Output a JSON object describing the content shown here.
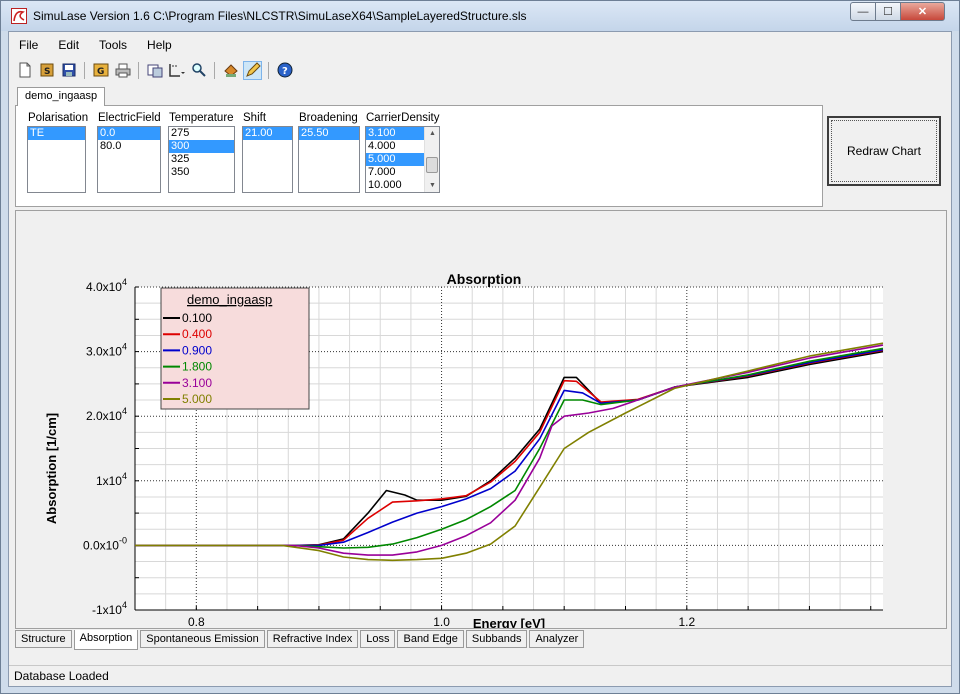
{
  "window": {
    "title": "SimuLase Version 1.6    C:\\Program Files\\NLCSTR\\SimuLaseX64\\SampleLayeredStructure.sls",
    "min_glyph": "—",
    "max_glyph": "☐",
    "close_glyph": "✕"
  },
  "menu": [
    "File",
    "Edit",
    "Tools",
    "Help"
  ],
  "toolbar": [
    "new-file-icon",
    "save-as-icon",
    "save-icon",
    "calculate-icon",
    "print-icon",
    "export-icon",
    "chart-options-icon",
    "zoom-icon",
    "run-icon",
    "pencil-icon",
    "help-icon"
  ],
  "document_tab": "demo_ingaasp",
  "params": {
    "polarisation": {
      "label": "Polarisation",
      "options": [
        "TE"
      ],
      "selected": [
        0
      ]
    },
    "electric_field": {
      "label": "ElectricField",
      "options": [
        "0.0",
        "80.0"
      ],
      "selected": [
        0
      ]
    },
    "temperature": {
      "label": "Temperature",
      "options": [
        "275",
        "300",
        "325",
        "350"
      ],
      "selected": [
        1
      ]
    },
    "shift": {
      "label": "Shift",
      "options": [
        "21.00"
      ],
      "selected": [
        0
      ]
    },
    "broadening": {
      "label": "Broadening",
      "options": [
        "25.50"
      ],
      "selected": [
        0
      ]
    },
    "carrier_density": {
      "label": "CarrierDensity",
      "options": [
        "3.100",
        "4.000",
        "5.000",
        "7.000",
        "10.000"
      ],
      "selected": [
        0,
        2
      ]
    }
  },
  "redraw_button": "Redraw Chart",
  "chart_data": {
    "type": "line",
    "title": "Absorption",
    "xlabel": "Energy [eV]",
    "ylabel": "Absorption [1/cm]",
    "xlim": [
      0.75,
      1.36
    ],
    "ylim": [
      -10000,
      40000
    ],
    "xticks": [
      {
        "v": 0.8,
        "label": "0.8"
      },
      {
        "v": 1.0,
        "label": "1.0"
      },
      {
        "v": 1.2,
        "label": "1.2"
      }
    ],
    "yticks": [
      {
        "v": 40000,
        "base": "4.0x10",
        "exp": "4"
      },
      {
        "v": 30000,
        "base": "3.0x10",
        "exp": "4"
      },
      {
        "v": 20000,
        "base": "2.0x10",
        "exp": "4"
      },
      {
        "v": 10000,
        "base": "1x10",
        "exp": "4"
      },
      {
        "v": 0,
        "base": "0.0x10",
        "exp": "-0"
      },
      {
        "v": -10000,
        "base": "-1x10",
        "exp": "4"
      }
    ],
    "legend_title": "demo_ingaasp",
    "legend_position": "top-left",
    "grid": true,
    "series": [
      {
        "name": "0.100",
        "color": "#000000",
        "points": [
          [
            0.75,
            0
          ],
          [
            0.88,
            0
          ],
          [
            0.9,
            100
          ],
          [
            0.92,
            1000
          ],
          [
            0.94,
            5000
          ],
          [
            0.955,
            8500
          ],
          [
            0.97,
            7800
          ],
          [
            0.98,
            7000
          ],
          [
            1.0,
            7000
          ],
          [
            1.02,
            7600
          ],
          [
            1.04,
            10000
          ],
          [
            1.06,
            13500
          ],
          [
            1.08,
            18000
          ],
          [
            1.1,
            26000
          ],
          [
            1.11,
            26000
          ],
          [
            1.13,
            22000
          ],
          [
            1.16,
            22500
          ],
          [
            1.19,
            24500
          ],
          [
            1.25,
            26000
          ],
          [
            1.3,
            28000
          ],
          [
            1.36,
            30000
          ]
        ]
      },
      {
        "name": "0.400",
        "color": "#dd0000",
        "points": [
          [
            0.75,
            0
          ],
          [
            0.88,
            0
          ],
          [
            0.9,
            50
          ],
          [
            0.92,
            800
          ],
          [
            0.94,
            4200
          ],
          [
            0.96,
            6700
          ],
          [
            0.98,
            6900
          ],
          [
            1.0,
            7200
          ],
          [
            1.02,
            7700
          ],
          [
            1.04,
            9800
          ],
          [
            1.06,
            13000
          ],
          [
            1.08,
            17500
          ],
          [
            1.1,
            25500
          ],
          [
            1.11,
            25400
          ],
          [
            1.13,
            22200
          ],
          [
            1.16,
            22600
          ],
          [
            1.19,
            24500
          ],
          [
            1.25,
            26200
          ],
          [
            1.3,
            28200
          ],
          [
            1.36,
            30200
          ]
        ]
      },
      {
        "name": "0.900",
        "color": "#0000cc",
        "points": [
          [
            0.75,
            0
          ],
          [
            0.88,
            0
          ],
          [
            0.9,
            0
          ],
          [
            0.92,
            500
          ],
          [
            0.94,
            2000
          ],
          [
            0.96,
            3600
          ],
          [
            0.98,
            5000
          ],
          [
            1.0,
            6000
          ],
          [
            1.02,
            7200
          ],
          [
            1.04,
            8800
          ],
          [
            1.06,
            11500
          ],
          [
            1.08,
            16500
          ],
          [
            1.1,
            24000
          ],
          [
            1.115,
            23600
          ],
          [
            1.13,
            22000
          ],
          [
            1.16,
            22500
          ],
          [
            1.19,
            24500
          ],
          [
            1.25,
            26300
          ],
          [
            1.3,
            28300
          ],
          [
            1.36,
            30300
          ]
        ]
      },
      {
        "name": "1.800",
        "color": "#008800",
        "points": [
          [
            0.75,
            0
          ],
          [
            0.88,
            0
          ],
          [
            0.9,
            -200
          ],
          [
            0.92,
            -400
          ],
          [
            0.94,
            -300
          ],
          [
            0.96,
            200
          ],
          [
            0.98,
            1200
          ],
          [
            1.0,
            2500
          ],
          [
            1.02,
            4000
          ],
          [
            1.04,
            6000
          ],
          [
            1.06,
            8500
          ],
          [
            1.08,
            15000
          ],
          [
            1.1,
            22500
          ],
          [
            1.115,
            22500
          ],
          [
            1.13,
            21800
          ],
          [
            1.16,
            22500
          ],
          [
            1.19,
            24500
          ],
          [
            1.25,
            26400
          ],
          [
            1.3,
            28500
          ],
          [
            1.36,
            30500
          ]
        ]
      },
      {
        "name": "3.100",
        "color": "#990099",
        "points": [
          [
            0.75,
            0
          ],
          [
            0.88,
            0
          ],
          [
            0.9,
            -400
          ],
          [
            0.92,
            -1200
          ],
          [
            0.94,
            -1500
          ],
          [
            0.96,
            -1500
          ],
          [
            0.98,
            -1000
          ],
          [
            1.0,
            0
          ],
          [
            1.02,
            1500
          ],
          [
            1.04,
            3500
          ],
          [
            1.06,
            7000
          ],
          [
            1.08,
            13500
          ],
          [
            1.09,
            18500
          ],
          [
            1.1,
            20000
          ],
          [
            1.12,
            20500
          ],
          [
            1.14,
            21200
          ],
          [
            1.16,
            22500
          ],
          [
            1.19,
            24500
          ],
          [
            1.25,
            26800
          ],
          [
            1.3,
            29000
          ],
          [
            1.36,
            31000
          ]
        ]
      },
      {
        "name": "5.000",
        "color": "#808000",
        "points": [
          [
            0.75,
            0
          ],
          [
            0.87,
            0
          ],
          [
            0.9,
            -800
          ],
          [
            0.92,
            -1800
          ],
          [
            0.94,
            -2200
          ],
          [
            0.96,
            -2300
          ],
          [
            0.98,
            -2200
          ],
          [
            1.0,
            -2000
          ],
          [
            1.02,
            -1200
          ],
          [
            1.04,
            200
          ],
          [
            1.06,
            3000
          ],
          [
            1.08,
            9000
          ],
          [
            1.1,
            15000
          ],
          [
            1.12,
            17500
          ],
          [
            1.15,
            20500
          ],
          [
            1.19,
            24300
          ],
          [
            1.25,
            27000
          ],
          [
            1.3,
            29300
          ],
          [
            1.36,
            31300
          ]
        ]
      }
    ]
  },
  "bottom_tabs": [
    {
      "label": "Structure",
      "active": false
    },
    {
      "label": "Absorption",
      "active": true
    },
    {
      "label": "Spontaneous Emission",
      "active": false
    },
    {
      "label": "Refractive Index",
      "active": false
    },
    {
      "label": "Loss",
      "active": false
    },
    {
      "label": "Band Edge",
      "active": false
    },
    {
      "label": "Subbands",
      "active": false
    },
    {
      "label": "Analyzer",
      "active": false
    }
  ],
  "status": "Database Loaded"
}
